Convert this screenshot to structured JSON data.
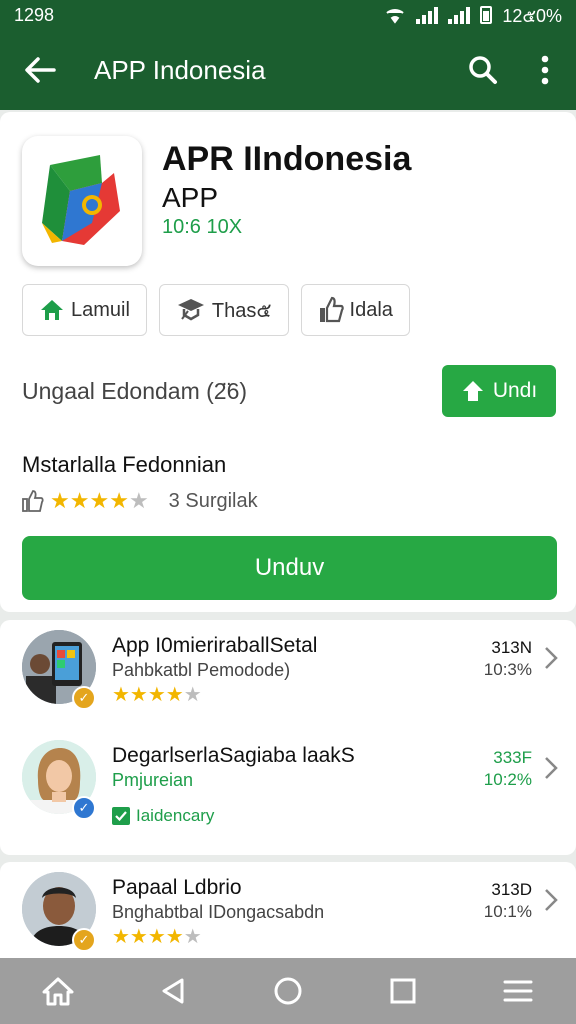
{
  "status": {
    "time": "1298",
    "right_time": "12๕0%"
  },
  "appbar": {
    "title": "APP Indonesia"
  },
  "app": {
    "name": "APR IIndonesia",
    "subtitle": "APP",
    "meta": "10:6  10X"
  },
  "chips": [
    {
      "label": "Lamuil",
      "icon": "home-icon"
    },
    {
      "label": "Thas๕",
      "icon": "graduation-cap-icon"
    },
    {
      "label": "Idala",
      "icon": "thumbs-up-icon"
    }
  ],
  "install_row": {
    "label": "Ungaal Edondam (2̈6)",
    "button": "Undı"
  },
  "developer": {
    "name": "Mstarlalla Fedonnian",
    "stars": 4,
    "reviews": "3 Surgilak"
  },
  "primary_button": "Unduv",
  "related": [
    {
      "title": "App I0mieriraballSetal",
      "subtitle": "Pahbkatbl Pemodode)",
      "right1": "313N",
      "right2": "10:3%",
      "stars": 4,
      "badge_color": "#e4a51d"
    },
    {
      "title": "DegarlserlaSagiaba laakS",
      "subtitle": "Pmjureian",
      "right1": "333F",
      "right2": "10:2%",
      "verified": "Iaidencary",
      "badge_color": "#2f77d1"
    },
    {
      "title": "Papaal Ldbrio",
      "subtitle": "Bnghabtbal IDongacsabdn",
      "right1": "313D",
      "right2": "10:1%",
      "stars": 4,
      "badge_color": "#e4a51d"
    }
  ],
  "colors": {
    "primary_green": "#27a844",
    "dark_green": "#1b5e2f",
    "star": "#f2b600"
  }
}
